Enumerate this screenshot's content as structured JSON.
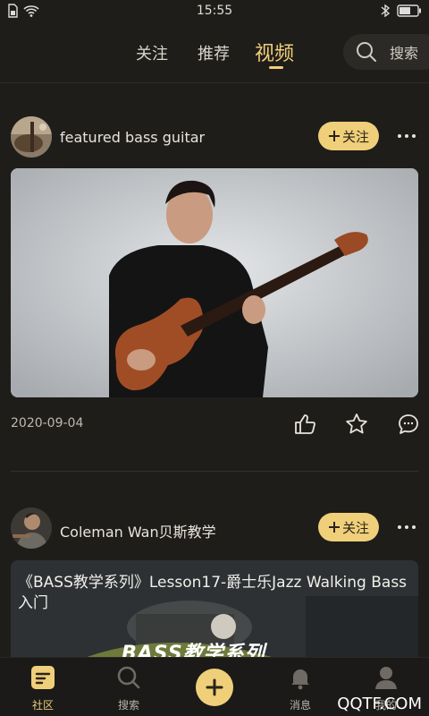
{
  "status_bar": {
    "time": "15:55"
  },
  "tabs": [
    {
      "label": "关注"
    },
    {
      "label": "推荐"
    },
    {
      "label": "视频"
    }
  ],
  "search": {
    "label": "搜索"
  },
  "posts": [
    {
      "author": "featured bass guitar",
      "follow_label": "关注",
      "date": "2020-09-04"
    },
    {
      "author": "Coleman Wan贝斯教学",
      "follow_label": "关注",
      "video_title": "《BASS教学系列》Lesson17-爵士乐Jazz Walking Bass入门",
      "video_banner": "BASS教学系列"
    }
  ],
  "bottom_nav": [
    {
      "label": "社区"
    },
    {
      "label": "搜索"
    },
    {
      "label": "消息"
    },
    {
      "label": "我的"
    }
  ],
  "watermark": "QQTF.COM",
  "colors": {
    "accent": "#f0cf7a",
    "background": "#1f1d1a"
  }
}
